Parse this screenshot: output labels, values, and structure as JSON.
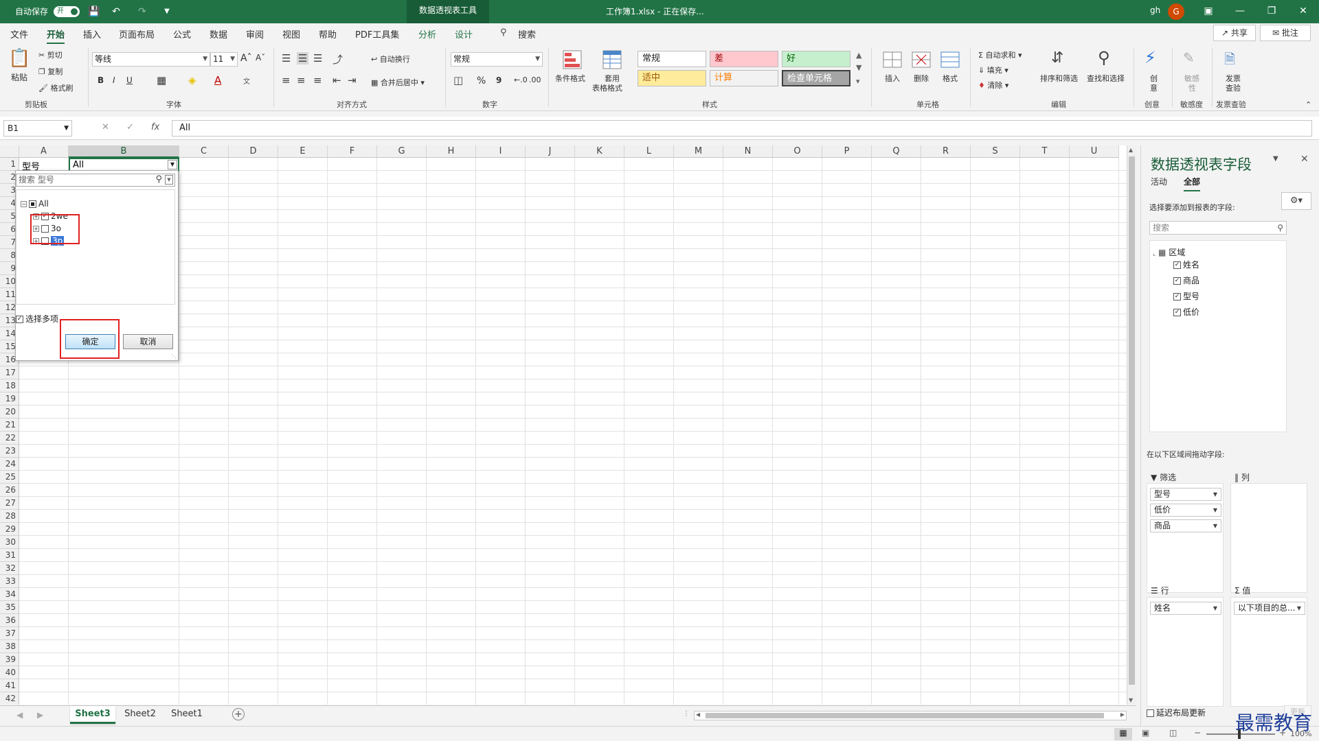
{
  "titlebar": {
    "autosave_label": "自动保存",
    "autosave_state": "开",
    "context_tab": "数据透视表工具",
    "filename": "工作簿1.xlsx - 正在保存...",
    "user": "gh",
    "avatar_letter": "G"
  },
  "menu": {
    "items": [
      "文件",
      "开始",
      "插入",
      "页面布局",
      "公式",
      "数据",
      "审阅",
      "视图",
      "帮助",
      "PDF工具集",
      "分析",
      "设计"
    ],
    "active": "开始",
    "search_label": "搜索",
    "share_label": "共享",
    "note_label": "批注"
  },
  "ribbon": {
    "clipboard": {
      "paste": "粘贴",
      "cut": "剪切",
      "copy": "复制",
      "format_painter": "格式刷",
      "group_label": "剪贴板"
    },
    "font": {
      "font_name": "等线",
      "font_size": "11",
      "bold": "B",
      "italic": "I",
      "underline": "U",
      "font_color_letter": "A",
      "group_label": "字体"
    },
    "alignment": {
      "wrap_text": "自动换行",
      "merge_center": "合并后居中",
      "group_label": "对齐方式"
    },
    "number": {
      "format": "常规",
      "percent": "%",
      "comma": "9",
      "group_label": "数字"
    },
    "styles": {
      "conditional_format": "条件格式",
      "table_format_line1": "套用",
      "table_format_line2": "表格格式",
      "cell_styles": [
        "常规",
        "差",
        "好",
        "适中",
        "计算",
        "检查单元格"
      ],
      "group_label": "样式"
    },
    "cells": {
      "insert": "插入",
      "delete": "删除",
      "format": "格式",
      "group_label": "单元格"
    },
    "editing": {
      "autosum": "自动求和",
      "fill": "填充",
      "clear": "清除",
      "sort_filter": "排序和筛选",
      "find_select": "查找和选择",
      "group_label": "编辑"
    },
    "creative": {
      "label_line1": "创",
      "label_line2": "意",
      "group_label": "创意"
    },
    "sensitivity": {
      "label_line1": "敏感",
      "label_line2": "性",
      "group_label": "敏感度"
    },
    "invoice": {
      "label_line1": "发票",
      "label_line2": "查验",
      "group_label": "发票查验"
    }
  },
  "formula_bar": {
    "name_box": "B1",
    "fx": "fx",
    "value": "All"
  },
  "grid": {
    "columns": [
      "A",
      "B",
      "C",
      "D",
      "E",
      "F",
      "G",
      "H",
      "I",
      "J",
      "K",
      "L",
      "M",
      "N",
      "O",
      "P",
      "Q",
      "R",
      "S",
      "T",
      "U"
    ],
    "selected_column": "B",
    "rows_visible": [
      "1",
      "2",
      "3",
      "4",
      "5",
      "6",
      "7",
      "8",
      "9",
      "10",
      "11",
      "12",
      "13",
      "14",
      "15",
      "16",
      "17",
      "18",
      "19",
      "20",
      "21",
      "22",
      "23",
      "24",
      "25",
      "26",
      "27",
      "28",
      "29",
      "30",
      "31",
      "32",
      "33",
      "34",
      "35",
      "36",
      "37",
      "38",
      "39",
      "40",
      "41",
      "42"
    ],
    "cells": {
      "A1": "型号",
      "B1": "All"
    }
  },
  "filter_popup": {
    "search_placeholder": "搜索 型号",
    "items": [
      {
        "label": "All",
        "state": "partial"
      },
      {
        "label": "2we",
        "state": "checked"
      },
      {
        "label": "3o",
        "state": "unchecked"
      },
      {
        "label": "3p",
        "state": "unchecked"
      }
    ],
    "multi_select_label": "选择多项",
    "ok_label": "确定",
    "cancel_label": "取消"
  },
  "sheets": {
    "tabs": [
      "Sheet3",
      "Sheet2",
      "Sheet1"
    ],
    "active": "Sheet3"
  },
  "status": {
    "zoom": "100%"
  },
  "pivot_pane": {
    "title": "数据透视表字段",
    "tabs": [
      "活动",
      "全部"
    ],
    "active_tab": "全部",
    "choose_label": "选择要添加到报表的字段:",
    "search_placeholder": "搜索",
    "table_name": "区域",
    "fields": [
      {
        "name": "姓名",
        "checked": true
      },
      {
        "name": "商品",
        "checked": true
      },
      {
        "name": "型号",
        "checked": true
      },
      {
        "name": "低价",
        "checked": true
      }
    ],
    "drag_label": "在以下区域间拖动字段:",
    "areas": {
      "filter": {
        "label": "筛选",
        "items": [
          "型号",
          "低价",
          "商品"
        ]
      },
      "columns": {
        "label": "列",
        "items": []
      },
      "rows": {
        "label": "行",
        "items": [
          "姓名"
        ]
      },
      "values": {
        "label": "值",
        "items": [
          "以下项目的总..."
        ]
      }
    },
    "defer_label": "延迟布局更新",
    "update_label": "更新"
  },
  "watermark": "最需教育",
  "colors": {
    "excel_green": "#217346",
    "dark_green": "#185c37",
    "highlight_red": "#e02020"
  }
}
